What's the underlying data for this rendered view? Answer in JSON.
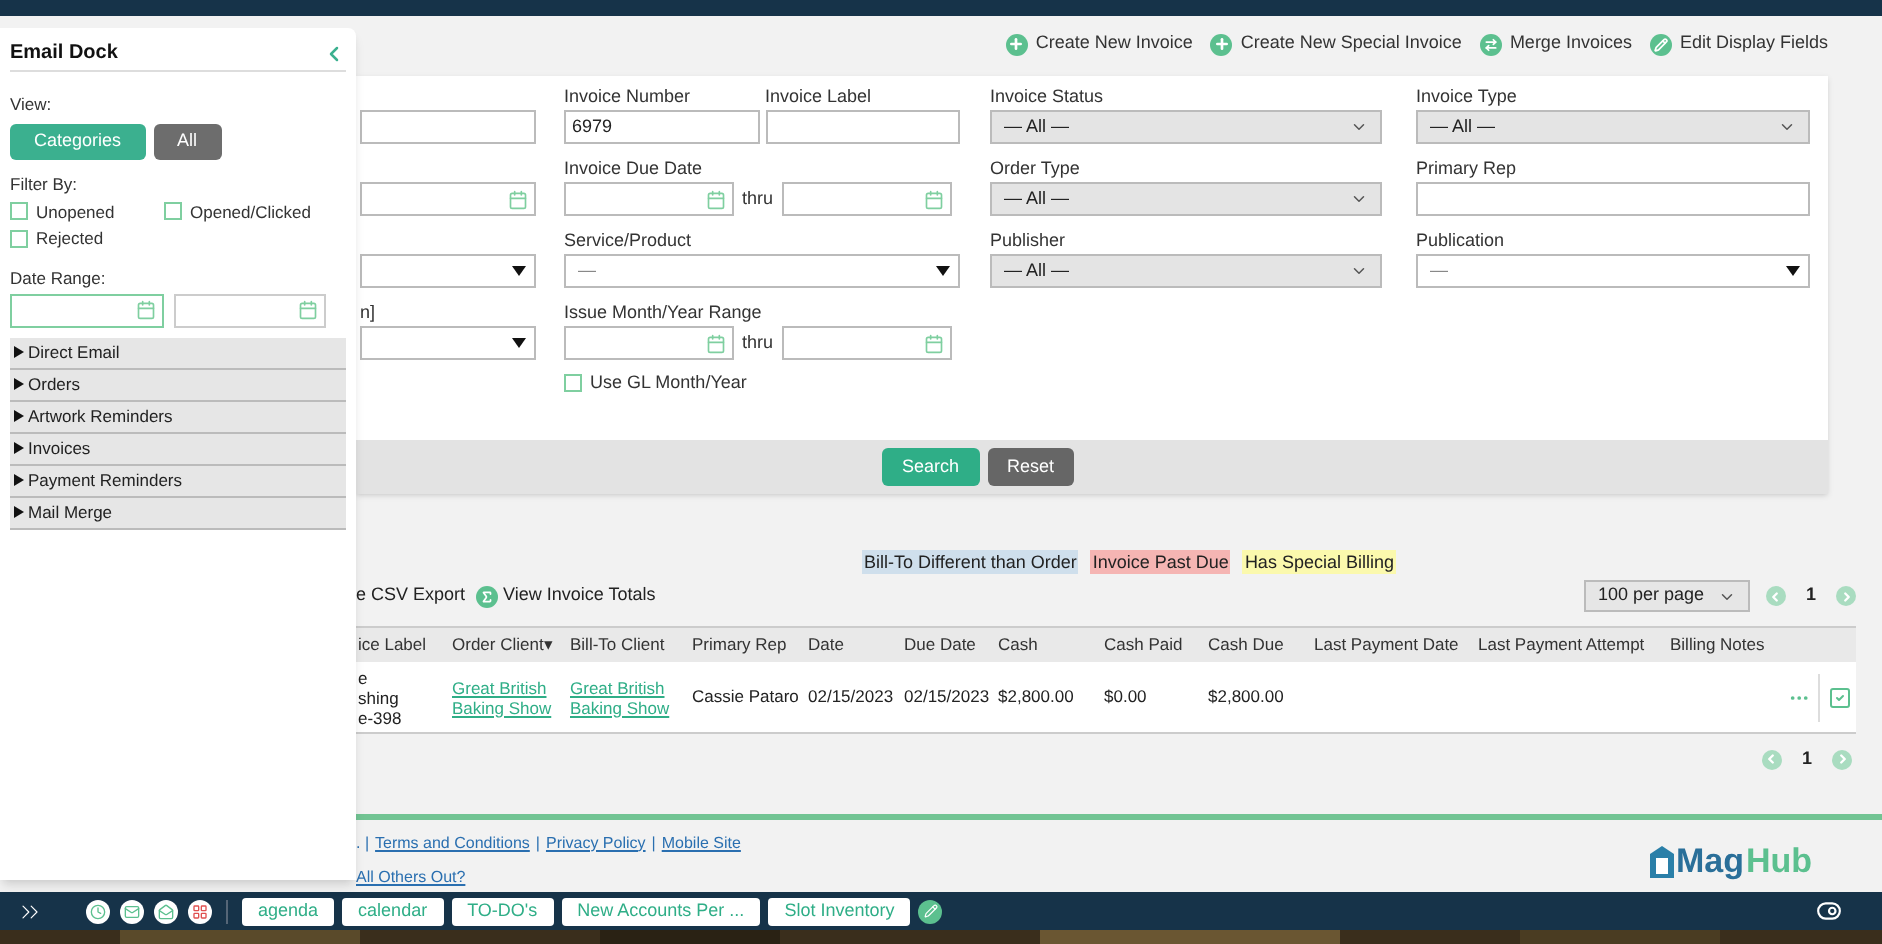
{
  "toolbar_actions": [
    {
      "kind": "plus",
      "label": "Create New Invoice"
    },
    {
      "kind": "plus",
      "label": "Create New Special Invoice"
    },
    {
      "kind": "merge",
      "label": "Merge Invoices"
    },
    {
      "kind": "edit",
      "label": "Edit Display Fields"
    }
  ],
  "search_form": {
    "rows": [
      {
        "cells": [
          [
            {
              "kind": "text"
            }
          ],
          [
            {
              "kind": "text",
              "label": "Invoice Number",
              "value": "6979"
            },
            {
              "kind": "text",
              "label": "Invoice Label"
            }
          ],
          [
            {
              "kind": "select",
              "label": "Invoice Status",
              "value": "— All —"
            }
          ],
          [
            {
              "kind": "select",
              "label": "Invoice Type",
              "value": "— All —"
            }
          ]
        ]
      },
      {
        "cells": [
          [
            {
              "kind": "date"
            }
          ],
          [
            {
              "kind": "date_range",
              "label": "Invoice Due Date",
              "separator": "thru"
            }
          ],
          [
            {
              "kind": "select",
              "label": "Order Type",
              "value": "— All —"
            }
          ],
          [
            {
              "kind": "text",
              "label": "Primary Rep"
            }
          ]
        ]
      },
      {
        "cells": [
          [
            {
              "kind": "combo"
            }
          ],
          [
            {
              "kind": "combo",
              "label": "Service/Product",
              "value": "—"
            }
          ],
          [
            {
              "kind": "select",
              "label": "Publisher",
              "value": "— All —"
            }
          ],
          [
            {
              "kind": "combo",
              "label": "Publication",
              "value": "—"
            }
          ]
        ]
      },
      {
        "cells": [
          [
            {
              "kind": "combo",
              "label": "n]"
            }
          ],
          [
            {
              "kind": "date_range",
              "label": "Issue Month/Year Range",
              "separator": "thru"
            },
            {
              "kind": "checkbox",
              "label": "Use GL Month/Year",
              "checked": false
            }
          ],
          [],
          []
        ]
      }
    ],
    "buttons": [
      {
        "kind": "primary",
        "label": "Search"
      },
      {
        "kind": "secondary",
        "label": "Reset"
      }
    ]
  },
  "legend": [
    {
      "label": "Bill-To Different than Order",
      "color": "#cfdfec"
    },
    {
      "label": "Invoice Past Due",
      "color": "#f5b5b3"
    },
    {
      "label": "Has Special Billing",
      "color": "#fbf9ad"
    }
  ],
  "list_tools": [
    {
      "kind": "plain",
      "label": "e CSV Export"
    },
    {
      "kind": "sigma",
      "label": "View Invoice Totals"
    }
  ],
  "per_page": "100 per page",
  "pagination_top": {
    "page": "1"
  },
  "table": {
    "columns": [
      "ice Label",
      "Order Client▾",
      "Bill-To Client",
      "Primary Rep",
      "Date",
      "Due Date",
      "Cash",
      "Cash Paid",
      "Cash Due",
      "Last Payment Date",
      "Last Payment Attempt",
      "Billing Notes"
    ],
    "rows": [
      {
        "cells": [
          {
            "kind": "lines",
            "lines": [
              "e",
              "shing",
              "e-398"
            ]
          },
          {
            "kind": "link",
            "text": "Great British Baking Show"
          },
          {
            "kind": "link",
            "text": "Great British Baking Show"
          },
          {
            "kind": "text",
            "text": "Cassie Pataro"
          },
          {
            "kind": "text",
            "text": "02/15/2023"
          },
          {
            "kind": "text",
            "text": "02/15/2023"
          },
          {
            "kind": "text",
            "text": "$2,800.00"
          },
          {
            "kind": "text",
            "text": "$0.00"
          },
          {
            "kind": "text",
            "text": "$2,800.00"
          },
          {
            "kind": "empty"
          },
          {
            "kind": "empty"
          },
          {
            "kind": "empty"
          }
        ],
        "checked": true
      }
    ]
  },
  "pagination_bottom": {
    "page": "1"
  },
  "footer": {
    "links_line": [
      ". |",
      {
        "link": "Terms and Conditions"
      },
      "|",
      {
        "link": "Privacy Policy"
      },
      "|",
      {
        "link": "Mobile Site"
      }
    ],
    "second_link": "All Others Out?",
    "logo": {
      "part1": "Mag",
      "part2": "Hub"
    }
  },
  "email_dock": {
    "title": "Email Dock",
    "view_label": "View:",
    "view_options": [
      {
        "label": "Categories",
        "selected": true
      },
      {
        "label": "All",
        "selected": false
      }
    ],
    "filter_label": "Filter By:",
    "filters": [
      {
        "label": "Unopened",
        "checked": false
      },
      {
        "label": "Opened/Clicked",
        "checked": false
      },
      {
        "label": "Rejected",
        "checked": false
      }
    ],
    "date_range_label": "Date Range:",
    "categories": [
      {
        "label": "Direct Email",
        "expanded": false
      },
      {
        "label": "Orders",
        "expanded": false
      },
      {
        "label": "Artwork Reminders",
        "expanded": false
      },
      {
        "label": "Invoices",
        "expanded": false
      },
      {
        "label": "Payment Reminders",
        "expanded": false
      },
      {
        "label": "Mail Merge",
        "expanded": false
      }
    ]
  },
  "taskbar": {
    "buttons": [
      "agenda",
      "calendar",
      "TO-DO's",
      "New Accounts Per ...",
      "Slot Inventory"
    ]
  }
}
